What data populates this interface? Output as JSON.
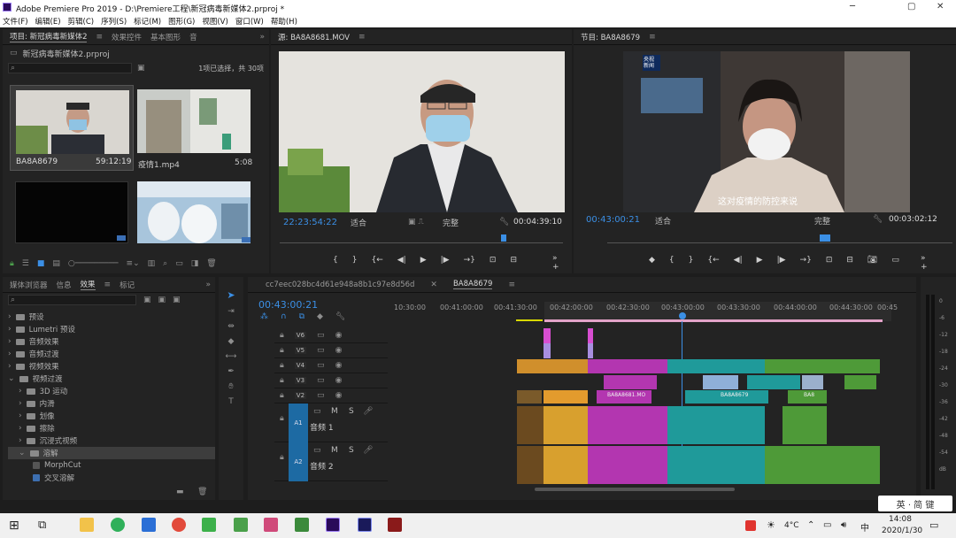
{
  "window": {
    "title": "Adobe Premiere Pro 2019 - D:\\Premiere工程\\新冠病毒新媒体2.prproj *"
  },
  "menu": [
    "文件(F)",
    "编辑(E)",
    "剪辑(C)",
    "序列(S)",
    "标记(M)",
    "图形(G)",
    "视图(V)",
    "窗口(W)",
    "帮助(H)"
  ],
  "project": {
    "tabs": [
      "项目: 新冠病毒新媒体2",
      "效果控件",
      "基本图形",
      "音"
    ],
    "file": "新冠病毒新媒体2.prproj",
    "selection": "1项已选择，共 30项",
    "items": [
      {
        "name": "BA8A8679",
        "dur": "59:12:19"
      },
      {
        "name": "疫情1.mp4",
        "dur": "5:08"
      },
      {
        "name": "",
        "dur": ""
      },
      {
        "name": "",
        "dur": ""
      }
    ]
  },
  "source": {
    "title": "源: BA8A8681.MOV",
    "timecode": "22:23:54:22",
    "fit": "适合",
    "quality": "完整",
    "duration": "00:04:39:10"
  },
  "program": {
    "title": "节目: BA8A8679",
    "timecode": "00:43:00:21",
    "fit": "适合",
    "quality": "完整",
    "duration": "00:03:02:12",
    "subtitle": "这对疫情的防控来说",
    "logo": "央视新闻"
  },
  "effects": {
    "tabs": [
      "媒体浏览器",
      "信息",
      "效果",
      "标记"
    ],
    "tree": [
      {
        "label": "预设",
        "indent": 0
      },
      {
        "label": "Lumetri 预设",
        "indent": 0
      },
      {
        "label": "音频效果",
        "indent": 0
      },
      {
        "label": "音频过渡",
        "indent": 0
      },
      {
        "label": "视频效果",
        "indent": 0
      },
      {
        "label": "视频过渡",
        "indent": 0
      },
      {
        "label": "3D 运动",
        "indent": 1
      },
      {
        "label": "内滑",
        "indent": 1
      },
      {
        "label": "划像",
        "indent": 1
      },
      {
        "label": "擦除",
        "indent": 1
      },
      {
        "label": "沉浸式视频",
        "indent": 1
      },
      {
        "label": "溶解",
        "indent": 1
      },
      {
        "label": "MorphCut",
        "indent": 2
      },
      {
        "label": "交叉溶解",
        "indent": 2
      }
    ]
  },
  "timeline": {
    "tabs": [
      "cc7eec028bc4d61e948a8b1c97e8d56d",
      "BA8A8679"
    ],
    "timecode": "00:43:00:21",
    "ruler": [
      "10:30:00",
      "00:41:00:00",
      "00:41:30:00",
      "00:42:00:00",
      "00:42:30:00",
      "00:43:00:00",
      "00:43:30:00",
      "00:44:00:00",
      "00:44:30:00",
      "00:45"
    ],
    "video_tracks": [
      "V6",
      "V5",
      "V4",
      "V3",
      "V2"
    ],
    "audio_tracks": [
      {
        "id": "A1",
        "name": "音频 1",
        "m": "M",
        "s": "S"
      },
      {
        "id": "A2",
        "name": "音频 2",
        "m": "M",
        "s": "S"
      }
    ],
    "clip_labels": [
      "BA8A8681.MO",
      "BA8A8679",
      "BA8"
    ]
  },
  "meters": [
    "0",
    "-6",
    "-12",
    "-18",
    "-24",
    "-30",
    "-36",
    "-42",
    "-48",
    "-54",
    "dB"
  ],
  "taskbar": {
    "time": "14:08",
    "date": "2020/1/30",
    "temp": "4°C",
    "ime": "英 · 简 键"
  },
  "colors": {
    "accent": "#3b8fe5",
    "video": "#d43fd1",
    "teal": "#2cb0b5",
    "green": "#4e9a38",
    "orange": "#e39b2d",
    "audio_hdr": "#1d6aa3"
  }
}
